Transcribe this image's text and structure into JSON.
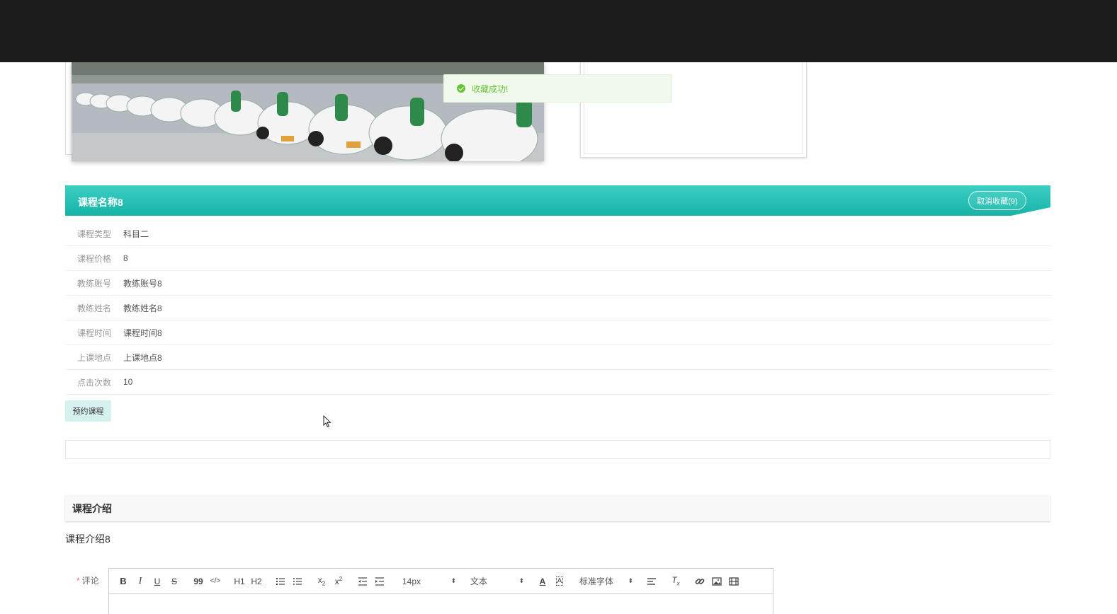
{
  "toast": {
    "message": "收藏成功!"
  },
  "course": {
    "title": "课程名称8",
    "unfavorite_label": "取消收藏(9)",
    "fields": [
      {
        "label": "课程类型",
        "value": "科目二"
      },
      {
        "label": "课程价格",
        "value": "8"
      },
      {
        "label": "教练账号",
        "value": "教练账号8"
      },
      {
        "label": "教练姓名",
        "value": "教练姓名8"
      },
      {
        "label": "课程时间",
        "value": "课程时间8"
      },
      {
        "label": "上课地点",
        "value": "上课地点8"
      },
      {
        "label": "点击次数",
        "value": "10"
      }
    ],
    "book_label": "预约课程"
  },
  "intro": {
    "heading": "课程介绍",
    "text": "课程介绍8"
  },
  "comment": {
    "required_mark": "*",
    "label": "评论",
    "toolbar": {
      "bold": "B",
      "italic": "I",
      "underline": "U",
      "strike": "S",
      "quote": "99",
      "code": "</>",
      "h1": "H1",
      "h2": "H2",
      "size": "14px",
      "header": "文本",
      "font": "标准字体"
    }
  },
  "colors": {
    "accent": "#16b3a7",
    "success": "#67c23a"
  }
}
